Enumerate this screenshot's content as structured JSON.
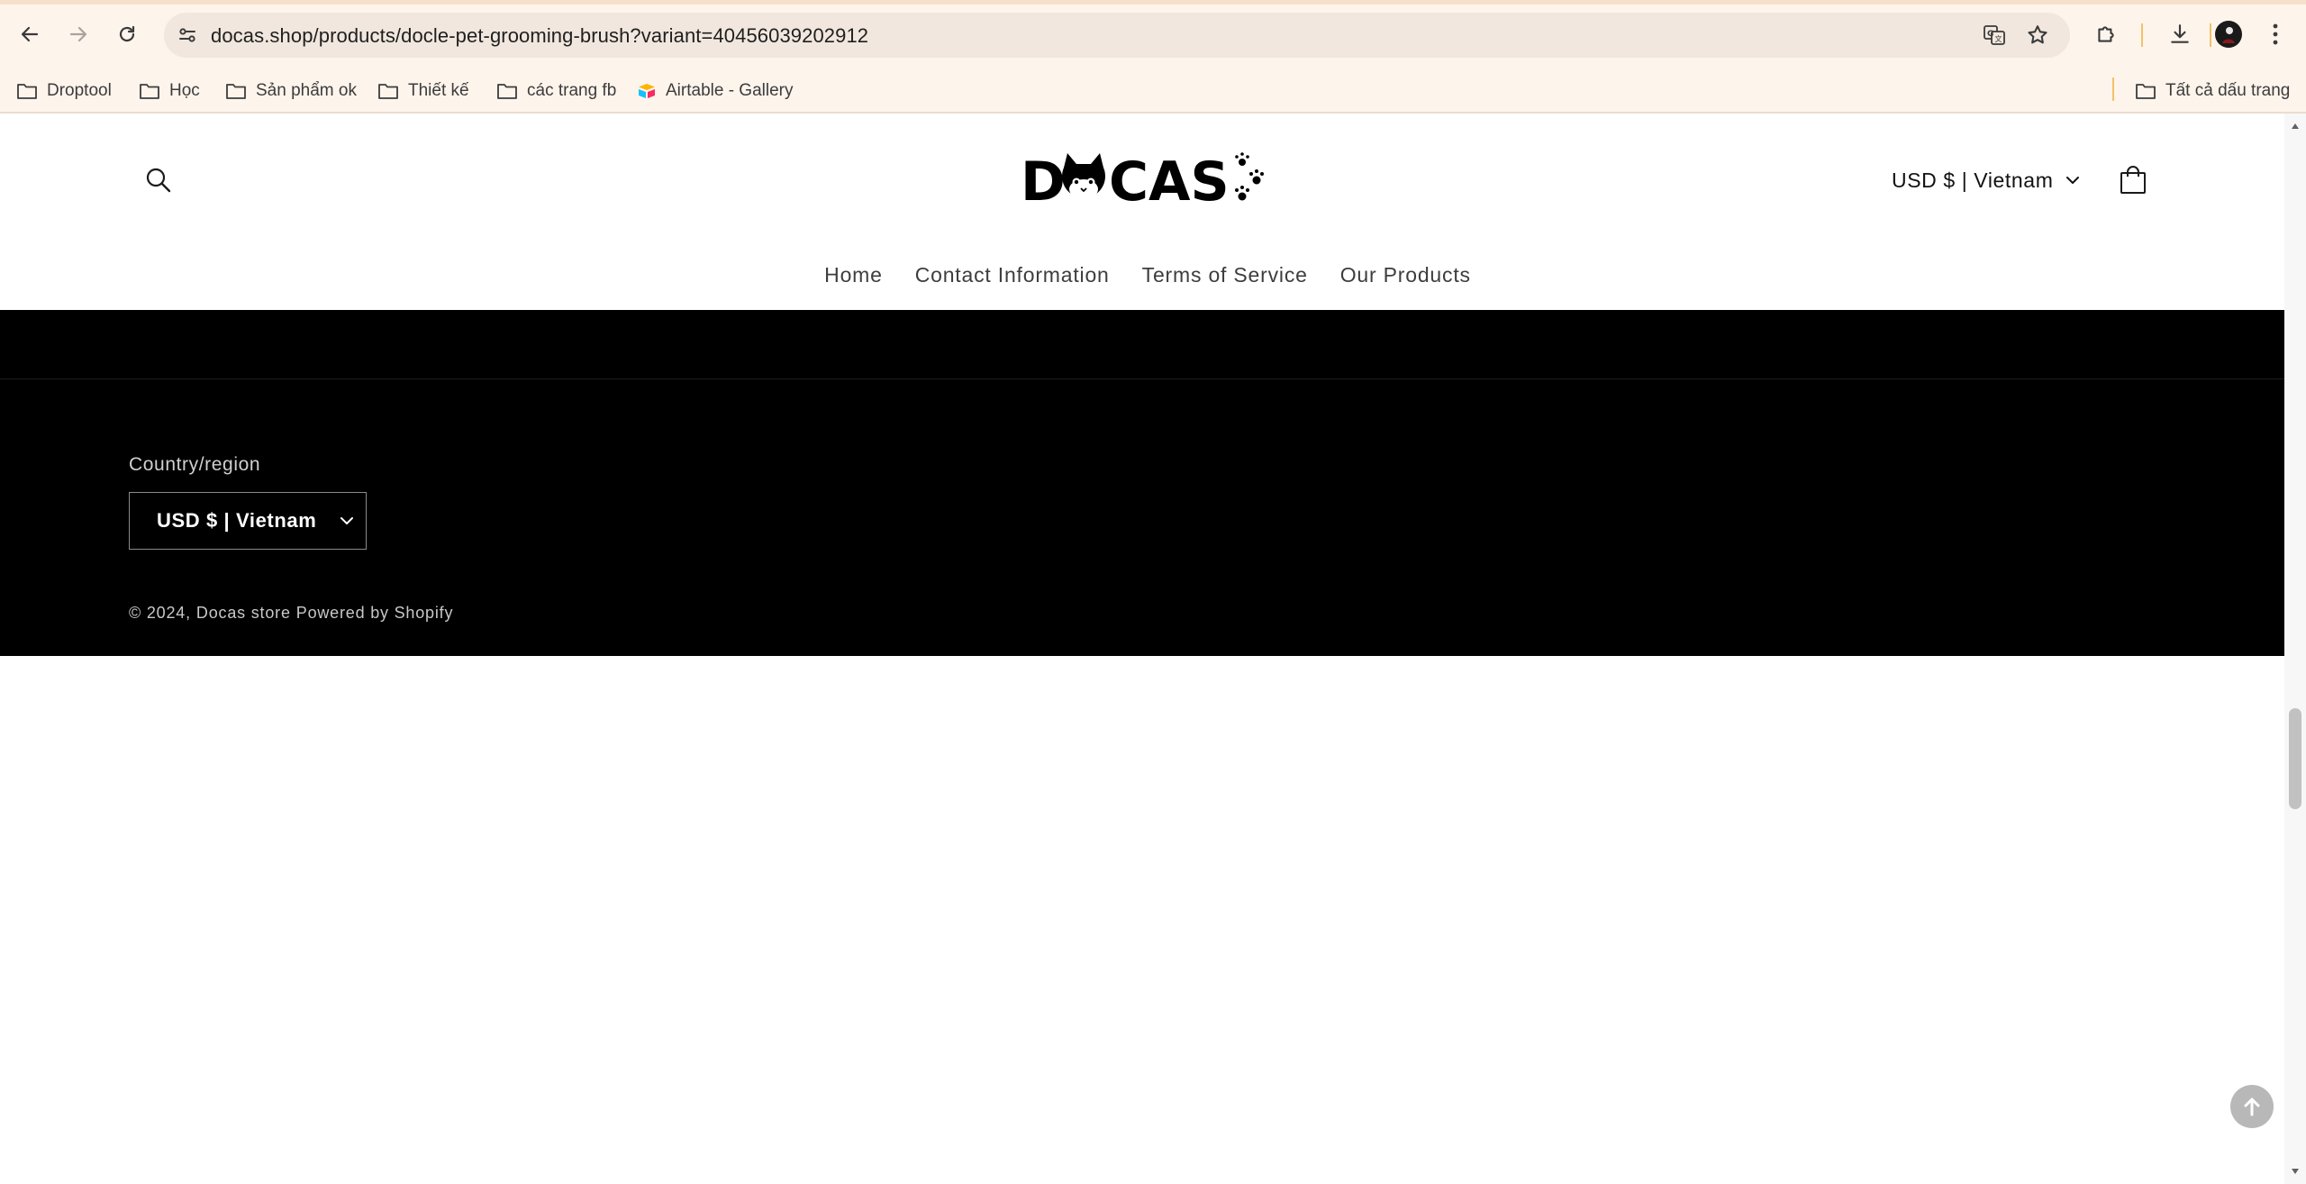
{
  "browser": {
    "url": "docas.shop/products/docle-pet-grooming-brush?variant=40456039202912",
    "bookmarks": [
      {
        "label": "Droptool",
        "icon": "folder-icon"
      },
      {
        "label": "Học",
        "icon": "folder-icon"
      },
      {
        "label": "Sản phẩm ok",
        "icon": "folder-icon"
      },
      {
        "label": "Thiết kế",
        "icon": "folder-icon"
      },
      {
        "label": "các trang fb",
        "icon": "folder-icon"
      },
      {
        "label": "Airtable - Gallery",
        "icon": "airtable-icon"
      }
    ],
    "all_bookmarks_label": "Tất cả dấu trang"
  },
  "header": {
    "logo_text": "DOCAS",
    "currency": "USD $ | Vietnam",
    "menu": [
      {
        "label": "Home"
      },
      {
        "label": "Contact Information"
      },
      {
        "label": "Terms of Service"
      },
      {
        "label": "Our Products"
      }
    ]
  },
  "footer": {
    "country_label": "Country/region",
    "country_value": "USD $ | Vietnam",
    "copyright": "© 2024,",
    "store_link": "Docas store",
    "powered": "Powered by Shopify"
  },
  "colors": {
    "chrome_bg": "#fdf4ec",
    "omnibox_bg": "#f1e7de",
    "footer_bg": "#000000",
    "page_bg": "#ffffff"
  }
}
